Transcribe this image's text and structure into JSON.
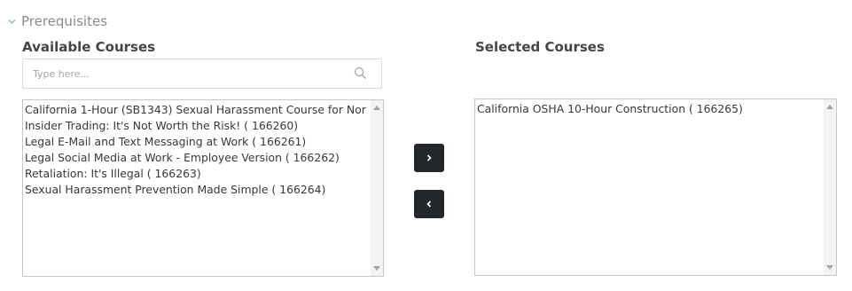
{
  "section": {
    "title": "Prerequisites",
    "toggle_icon": "chevron-down-icon"
  },
  "available": {
    "title": "Available Courses",
    "search_placeholder": "Type here...",
    "search_value": "",
    "search_icon": "search-icon",
    "items": [
      "California 1-Hour (SB1343) Sexual Harassment Course for Nor",
      "Insider Trading: It's Not Worth the Risk! ( 166260)",
      "Legal E-Mail and Text Messaging at Work ( 166261)",
      "Legal Social Media at Work - Employee Version ( 166262)",
      "Retaliation: It's Illegal ( 166263)",
      "Sexual Harassment Prevention Made Simple ( 166264)"
    ]
  },
  "selected": {
    "title": "Selected Courses",
    "items": [
      "California OSHA 10-Hour Construction ( 166265)"
    ]
  },
  "controls": {
    "add_icon": "chevron-right-icon",
    "remove_icon": "chevron-left-icon"
  },
  "colors": {
    "button_bg": "#23262b",
    "title_text": "#454545",
    "section_text": "#8a8a8a",
    "chevron": "#8fb8c9"
  }
}
